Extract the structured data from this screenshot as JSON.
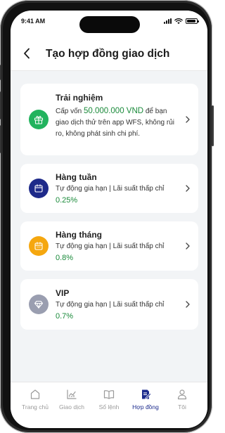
{
  "status_bar": {
    "time": "9:41 AM"
  },
  "header": {
    "title": "Tạo hợp đồng giao dịch"
  },
  "contracts": [
    {
      "title": "Trải nghiệm",
      "desc_prefix": "Cấp vốn ",
      "desc_amount": "50.000.000 VND",
      "desc_suffix": " để bạn giao dịch thử trên app WFS, không rủi ro, không phát sinh chi phí.",
      "icon": "gift-icon",
      "icon_color": "#22b35e"
    },
    {
      "title": "Hàng tuần",
      "desc": "Tự động gia hạn | Lãi suất thấp chỉ",
      "rate": "0.25%",
      "icon": "calendar-icon",
      "icon_color": "#1e2a8a"
    },
    {
      "title": "Hàng tháng",
      "desc": "Tự động gia hạn | Lãi suất thấp chỉ",
      "rate": "0.8%",
      "icon": "calendar-icon",
      "icon_color": "#f5a70f"
    },
    {
      "title": "VIP",
      "desc": "Tự động gia hạn | Lãi suất thấp chỉ",
      "rate": "0.7%",
      "icon": "diamond-icon",
      "icon_color": "#9a9eb0"
    }
  ],
  "tabs": [
    {
      "label": "Trang chủ",
      "icon": "home-icon",
      "active": false
    },
    {
      "label": "Giao dịch",
      "icon": "chart-icon",
      "active": false
    },
    {
      "label": "Sổ lệnh",
      "icon": "book-icon",
      "active": false
    },
    {
      "label": "Hợp đồng",
      "icon": "contract-icon",
      "active": true
    },
    {
      "label": "Tôi",
      "icon": "user-icon",
      "active": false
    }
  ],
  "colors": {
    "accent": "#1b2a8c",
    "rate_green": "#1a8a3a",
    "background": "#f2f4f6"
  }
}
